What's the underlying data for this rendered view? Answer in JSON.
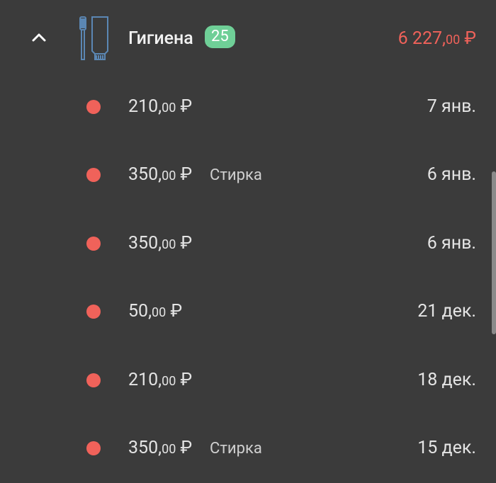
{
  "category": {
    "title": "Гигиена",
    "count": "25",
    "total": {
      "main": "6 227,",
      "cents": "00",
      "currency": " ₽"
    },
    "icon": "toothbrush-toothpaste-icon",
    "expanded": true
  },
  "colors": {
    "accent_red": "#f0625a",
    "badge_green": "#6fcf97",
    "background": "#3b3b3b",
    "icon_blue": "#5b87b4"
  },
  "transactions": [
    {
      "amount_main": "210,",
      "amount_cents": "00",
      "currency": " ₽",
      "note": "",
      "date": "7 янв."
    },
    {
      "amount_main": "350,",
      "amount_cents": "00",
      "currency": " ₽",
      "note": "Стирка",
      "date": "6 янв."
    },
    {
      "amount_main": "350,",
      "amount_cents": "00",
      "currency": " ₽",
      "note": "",
      "date": "6 янв."
    },
    {
      "amount_main": "50,",
      "amount_cents": "00",
      "currency": " ₽",
      "note": "",
      "date": "21 дек."
    },
    {
      "amount_main": "210,",
      "amount_cents": "00",
      "currency": " ₽",
      "note": "",
      "date": "18 дек."
    },
    {
      "amount_main": "350,",
      "amount_cents": "00",
      "currency": " ₽",
      "note": "Стирка",
      "date": "15 дек."
    }
  ]
}
